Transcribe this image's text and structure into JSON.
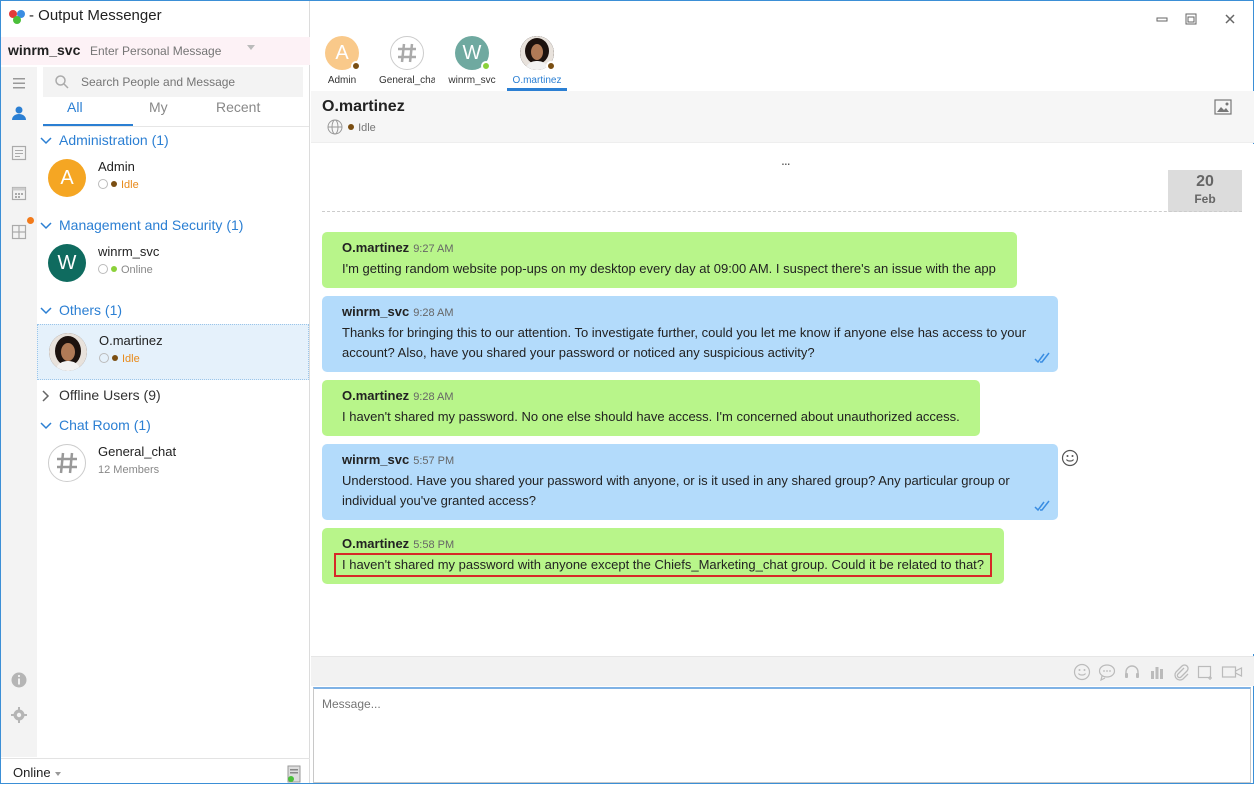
{
  "app": {
    "title": "- Output Messenger"
  },
  "user": {
    "name": "winrm_svc",
    "personal_message_placeholder": "Enter Personal Message"
  },
  "search": {
    "placeholder": "Search People and Message"
  },
  "tabs": [
    {
      "label": "All"
    },
    {
      "label": "My"
    },
    {
      "label": "Recent"
    }
  ],
  "groups": [
    {
      "label": "Administration (1)"
    },
    {
      "label": "Management and Security (1)"
    },
    {
      "label": "Others (1)"
    },
    {
      "label": "Offline Users (9)"
    },
    {
      "label": "Chat Room (1)"
    }
  ],
  "contacts": [
    {
      "name": "Admin",
      "initial": "A",
      "status": "Idle",
      "color": "#f5a623"
    },
    {
      "name": "winrm_svc",
      "initial": "W",
      "status": "Online",
      "color": "#0f6b5f"
    },
    {
      "name": "O.martinez",
      "status": "Idle"
    },
    {
      "name": "General_chat",
      "status": "12 Members"
    }
  ],
  "bottom": {
    "status": "Online"
  },
  "chat_tabs": [
    {
      "label": "Admin",
      "initial": "A",
      "color": "#f9c98a"
    },
    {
      "label": "General_chat"
    },
    {
      "label": "winrm_svc",
      "initial": "W",
      "color": "#6fa9a0"
    },
    {
      "label": "O.martinez"
    }
  ],
  "chat": {
    "name": "O.martinez",
    "status": "Idle",
    "more": "...",
    "date_day": "20",
    "date_month": "Feb",
    "message_placeholder": "Message..."
  },
  "messages": [
    {
      "sender": "O.martinez",
      "time": "9:27 AM",
      "text": "I'm getting random website pop-ups on my desktop every day at 09:00 AM. I suspect there's an issue with the app"
    },
    {
      "sender": "winrm_svc",
      "time": "9:28 AM",
      "text": "Thanks for bringing this to our attention. To investigate further, could you let me know if anyone else has access to your account? Also, have you shared your password or noticed any suspicious activity?"
    },
    {
      "sender": "O.martinez",
      "time": "9:28 AM",
      "text": "I haven't shared my password. No one else should have access. I'm concerned about unauthorized access."
    },
    {
      "sender": "winrm_svc",
      "time": "5:57 PM",
      "text": "Understood. Have you shared your password with anyone, or is it used in any shared group? Any particular group or individual you've granted access?"
    },
    {
      "sender": "O.martinez",
      "time": "5:58 PM",
      "text": "I haven't shared my password with anyone except the Chiefs_Marketing_chat group. Could it be related to that?"
    }
  ],
  "colors": {
    "accent": "#2b7fd3",
    "incoming_bubble": "#b8f58a",
    "outgoing_bubble": "#b3dbfb",
    "idle": "#e88a1a",
    "online": "#8bd13a",
    "highlight_box": "#d62828"
  }
}
